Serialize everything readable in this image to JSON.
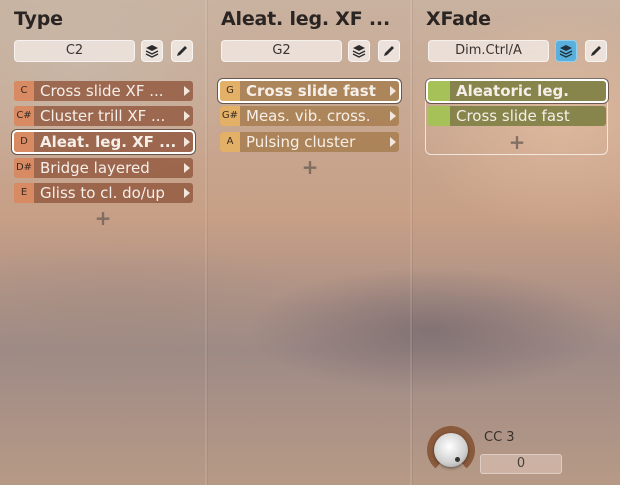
{
  "columns": [
    {
      "title": "Type",
      "selector_value": "C2",
      "items": [
        {
          "key": "C",
          "label": "Cross slide XF ..."
        },
        {
          "key": "C#",
          "label": "Cluster trill XF ..."
        },
        {
          "key": "D",
          "label": "Aleat. leg. XF ..."
        },
        {
          "key": "D#",
          "label": "Bridge layered"
        },
        {
          "key": "E",
          "label": "Gliss to cl. do/up"
        }
      ],
      "add_symbol": "+"
    },
    {
      "title": "Aleat. leg. XF ...",
      "selector_value": "G2",
      "items": [
        {
          "key": "G",
          "label": "Cross slide fast"
        },
        {
          "key": "G#",
          "label": "Meas. vib. cross."
        },
        {
          "key": "A",
          "label": "Pulsing cluster"
        }
      ],
      "add_symbol": "+"
    },
    {
      "title": "XFade",
      "selector_value": "Dim.Ctrl/A",
      "items": [
        {
          "label": "Aleatoric leg."
        },
        {
          "label": "Cross slide fast"
        }
      ],
      "add_symbol": "+"
    }
  ],
  "controller": {
    "label": "CC 3",
    "value": "0"
  },
  "colors": {
    "brown_item": "#945c42",
    "tan_item": "#a88052",
    "olive_item": "#7e8044",
    "active_button": "#5ab0dc"
  },
  "icons": {
    "layers": "layers-icon",
    "edit": "pencil-icon",
    "expand": "chevron-right-icon",
    "add": "plus-icon"
  }
}
